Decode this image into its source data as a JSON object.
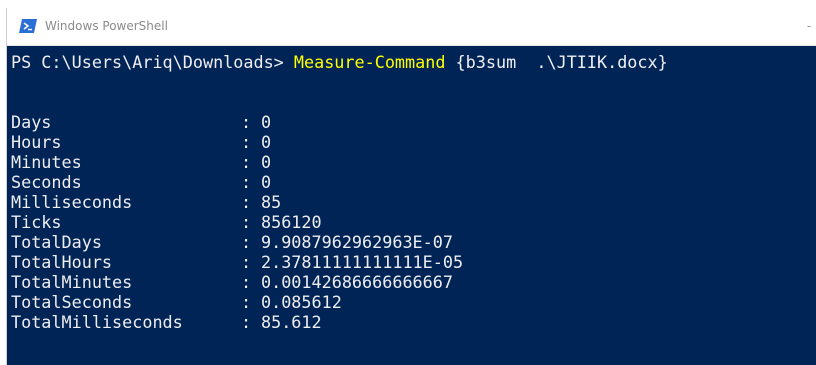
{
  "window": {
    "title": "Windows PowerShell",
    "icon": "powershell-icon",
    "minimize_glyph": "-"
  },
  "colors": {
    "console_bg": "#012456",
    "console_fg": "#eeedf0",
    "command": "#ffff00"
  },
  "console": {
    "prompt": "PS C:\\Users\\Ariq\\Downloads> ",
    "command": "Measure-Command",
    "args": " {b3sum  .\\JTIIK.docx}",
    "separator": ":",
    "rows": [
      {
        "label": "Days",
        "value": "0"
      },
      {
        "label": "Hours",
        "value": "0"
      },
      {
        "label": "Minutes",
        "value": "0"
      },
      {
        "label": "Seconds",
        "value": "0"
      },
      {
        "label": "Milliseconds",
        "value": "85"
      },
      {
        "label": "Ticks",
        "value": "856120"
      },
      {
        "label": "TotalDays",
        "value": "9.9087962962963E-07"
      },
      {
        "label": "TotalHours",
        "value": "2.37811111111111E-05"
      },
      {
        "label": "TotalMinutes",
        "value": "0.00142686666666667"
      },
      {
        "label": "TotalSeconds",
        "value": "0.085612"
      },
      {
        "label": "TotalMilliseconds",
        "value": "85.612"
      }
    ]
  }
}
